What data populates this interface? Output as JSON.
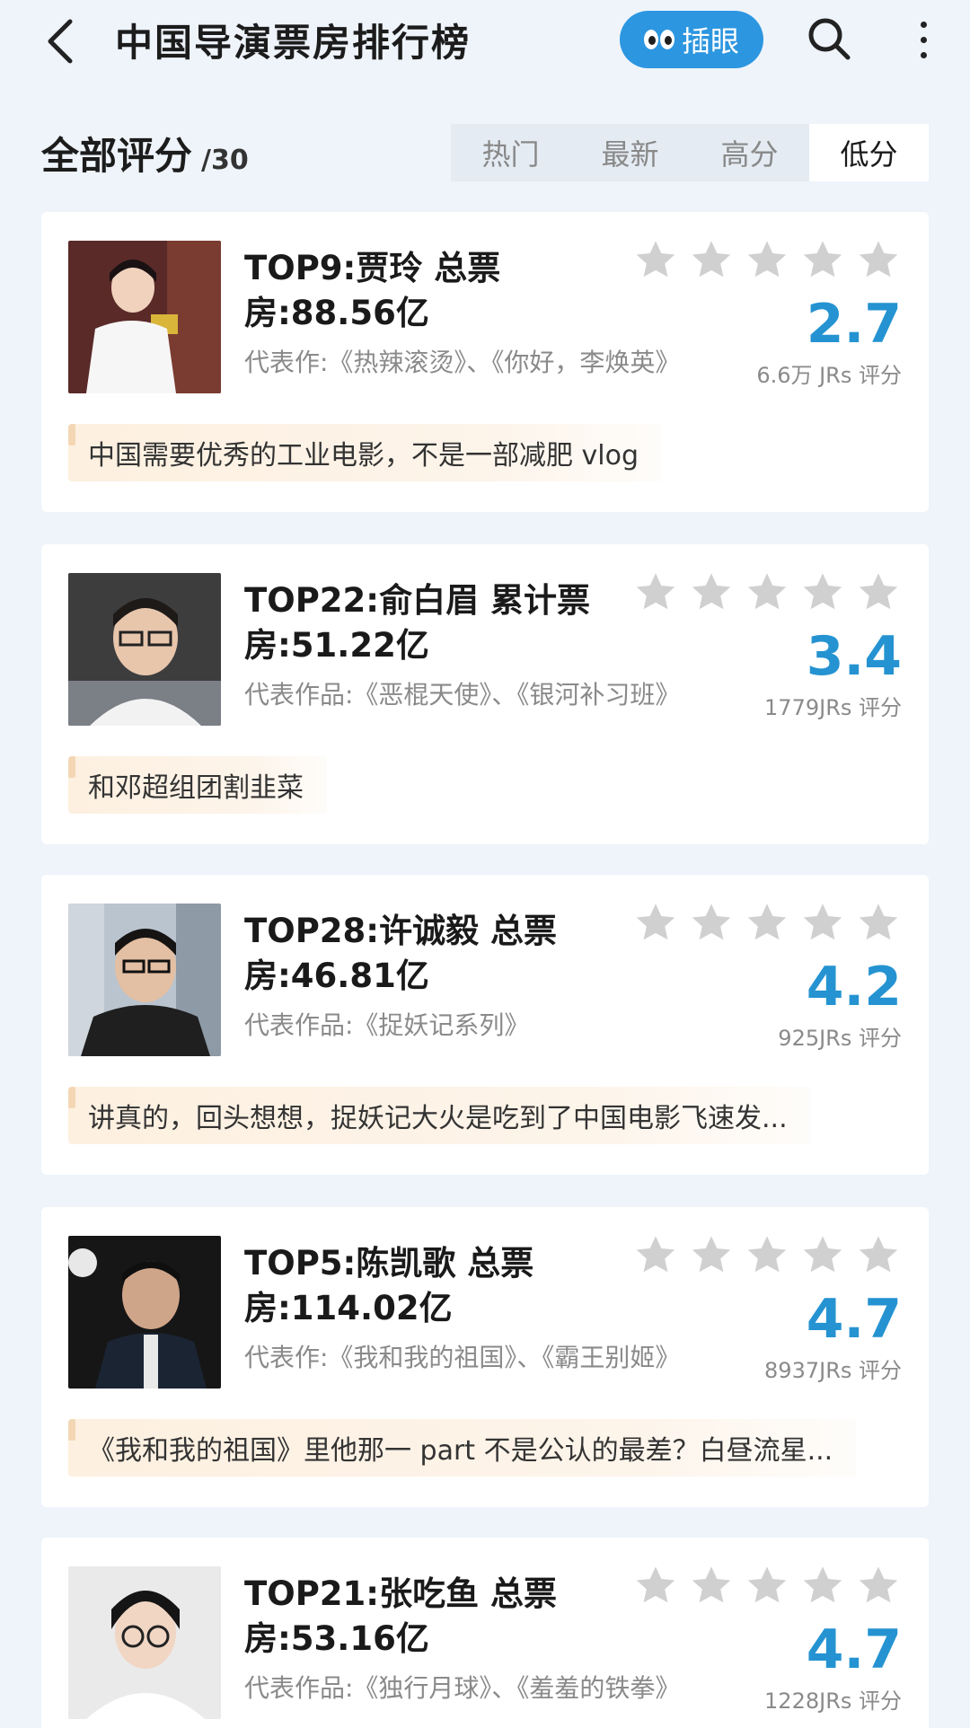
{
  "header": {
    "title": "中国导演票房排行榜",
    "peek_label": "插眼"
  },
  "section": {
    "title": "全部评分",
    "count": "/30"
  },
  "filters": [
    "热门",
    "最新",
    "高分",
    "低分"
  ],
  "active_filter": "低分",
  "accent_color": "#2593d1",
  "cards": [
    {
      "title_line1": "TOP9:贾玲 总票",
      "title_line2": "房:88.56亿",
      "works": "代表作:《热辣滚烫》、《你好，李焕英》",
      "score": "2.7",
      "raters": "6.6万 JRs 评分",
      "comment": "中国需要优秀的工业电影，不是一部减肥 vlog"
    },
    {
      "title_line1": "TOP22:俞白眉 累计票",
      "title_line2": "房:51.22亿",
      "works": "代表作品:《恶棍天使》、《银河补习班》",
      "score": "3.4",
      "raters": "1779JRs 评分",
      "comment": "和邓超组团割韭菜"
    },
    {
      "title_line1": "TOP28:许诚毅 总票",
      "title_line2": "房:46.81亿",
      "works": "代表作品:《捉妖记系列》",
      "score": "4.2",
      "raters": "925JRs 评分",
      "comment": "讲真的，回头想想，捉妖记大火是吃到了中国电影飞速发..."
    },
    {
      "title_line1": "TOP5:陈凯歌 总票",
      "title_line2": "房:114.02亿",
      "works": "代表作:《我和我的祖国》、《霸王别姬》",
      "score": "4.7",
      "raters": "8937JRs 评分",
      "comment": "《我和我的祖国》里他那一 part 不是公认的最差？白昼流星..."
    },
    {
      "title_line1": "TOP21:张吃鱼 总票",
      "title_line2": "房:53.16亿",
      "works": "代表作品:《独行月球》、《羞羞的铁拳》",
      "score": "4.7",
      "raters": "1228JRs 评分",
      "comment": ""
    }
  ]
}
